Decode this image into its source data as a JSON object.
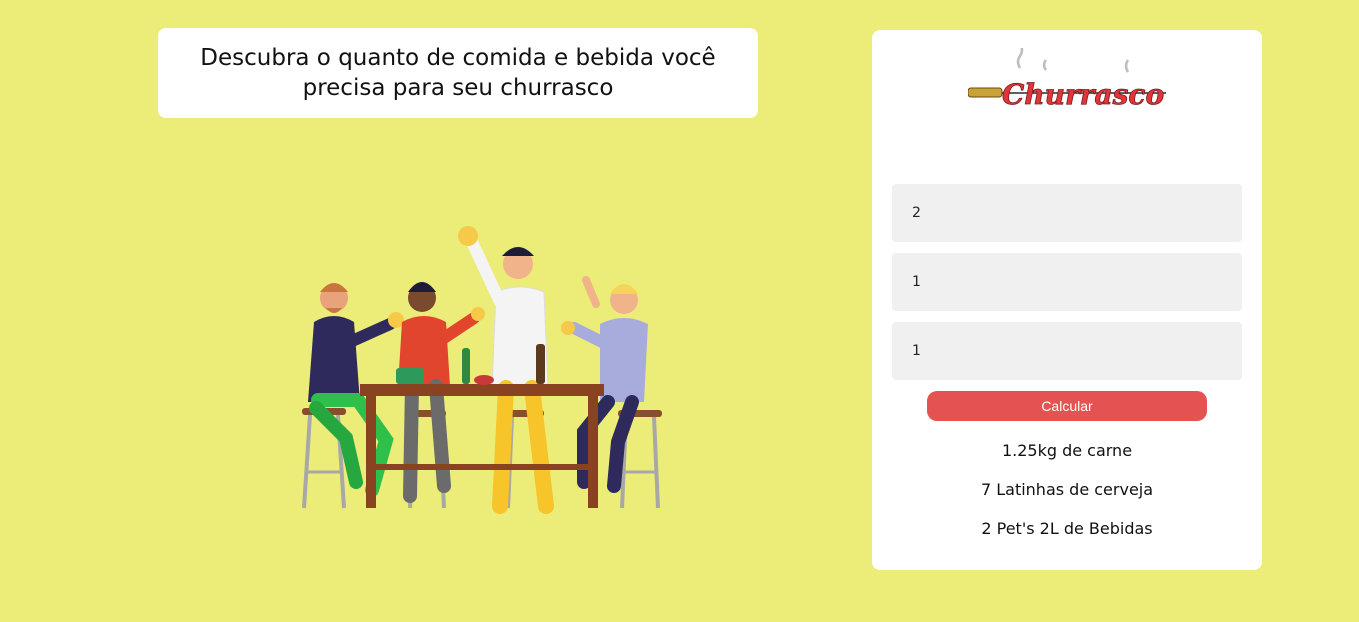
{
  "header": {
    "headline": "Descubra o quanto de comida e bebida você precisa para seu churrasco"
  },
  "logo": {
    "text": "Churrasco",
    "color": "#e0363b"
  },
  "form": {
    "fields": [
      {
        "value": "2"
      },
      {
        "value": "1"
      },
      {
        "value": "1"
      }
    ],
    "calculate_label": "Calcular"
  },
  "results": {
    "meat": "1.25kg de carne",
    "beer": "7 Latinhas de cerveja",
    "drinks": "2 Pet's 2L de Bebidas"
  },
  "colors": {
    "background": "#ecec78",
    "card": "#ffffff",
    "button": "#e55252",
    "field": "#f0f0f0"
  },
  "illustration": {
    "icon": "friends-toasting-at-table-illustration"
  }
}
